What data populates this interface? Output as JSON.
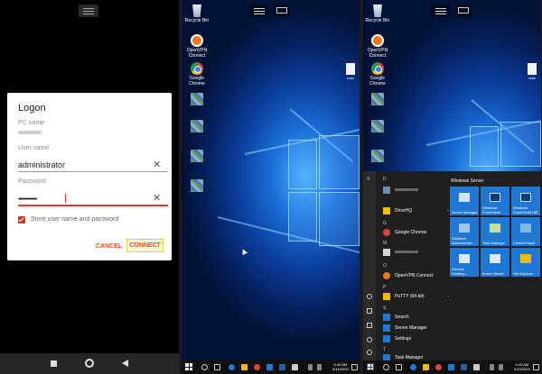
{
  "android": {
    "dialog": {
      "title": "Logon",
      "pc_name_label": "PC name",
      "user_name_label": "User name",
      "user_name_value": "administrator",
      "password_label": "Password",
      "password_value": "••••••••••••••",
      "store_label": "Store user name and password",
      "store_checked": true,
      "cancel_label": "CANCEL",
      "connect_label": "CONNECT"
    },
    "nav": [
      "recents-icon",
      "home-icon",
      "back-icon"
    ]
  },
  "desktop_icons": [
    {
      "name": "recycle-bin",
      "label": "Recycle Bin"
    },
    {
      "name": "openvpn-connect",
      "label": "OpenVPN Connect"
    },
    {
      "name": "google-chrome",
      "label": "Google Chrome"
    }
  ],
  "note_label": "note",
  "taskbar": {
    "time": "5:40 AM",
    "date": "9/15/2020"
  },
  "start_menu": {
    "tiles_header": "Windows Server",
    "list": [
      {
        "kind": "letter",
        "text": "D"
      },
      {
        "kind": "item",
        "text": "DriveHQ",
        "color": "#f2b90f",
        "chevron": true
      },
      {
        "kind": "letter",
        "text": "G"
      },
      {
        "kind": "item",
        "text": "Google Chrome",
        "color": "#db4437"
      },
      {
        "kind": "letter",
        "text": "M"
      },
      {
        "kind": "letter",
        "text": "O"
      },
      {
        "kind": "item",
        "text": "OpenVPN Connect",
        "color": "#ea7a1a"
      },
      {
        "kind": "letter",
        "text": "P"
      },
      {
        "kind": "item",
        "text": "PuTTY (64-bit)",
        "color": "#f2b90f",
        "chevron": true
      },
      {
        "kind": "letter",
        "text": "S"
      },
      {
        "kind": "item",
        "text": "Search",
        "color": "#1e78d4"
      },
      {
        "kind": "item",
        "text": "Server Manager",
        "color": "#1e78d4"
      },
      {
        "kind": "item",
        "text": "Settings",
        "color": "#1e78d4"
      },
      {
        "kind": "letter",
        "text": "T"
      },
      {
        "kind": "item",
        "text": "Task Manager",
        "color": "#1e78d4"
      }
    ],
    "tiles": [
      {
        "name": "tile-server-manager",
        "label": "Server Manager",
        "icon": "server-icon"
      },
      {
        "name": "tile-windows-powershell",
        "label": "Windows PowerShell",
        "icon": "powershell-icon"
      },
      {
        "name": "tile-windows-powershell-ise",
        "label": "Windows PowerShell ISE",
        "icon": "powershell-ise-icon"
      },
      {
        "name": "tile-windows-admin-tools",
        "label": "Windows Administrativ...",
        "icon": "admin-tools-icon"
      },
      {
        "name": "tile-task-manager",
        "label": "Task Manager",
        "icon": "task-manager-icon"
      },
      {
        "name": "tile-control-panel",
        "label": "Control Panel",
        "icon": "control-panel-icon"
      },
      {
        "name": "tile-remote-desktop",
        "label": "Remote Desktop...",
        "icon": "remote-desktop-icon"
      },
      {
        "name": "tile-event-viewer",
        "label": "Event Viewer",
        "icon": "event-viewer-icon"
      },
      {
        "name": "tile-file-explorer",
        "label": "File Explorer",
        "icon": "file-explorer-icon"
      }
    ]
  }
}
